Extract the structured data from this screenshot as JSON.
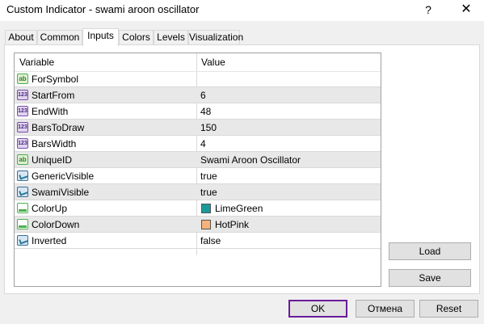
{
  "window": {
    "title": "Custom Indicator - swami aroon oscillator",
    "help": "?",
    "close": "✕"
  },
  "tabs": [
    "About",
    "Common",
    "Inputs",
    "Colors",
    "Levels",
    "Visualization"
  ],
  "active_tab": "Inputs",
  "grid": {
    "headers": {
      "variable": "Variable",
      "value": "Value"
    },
    "rows": [
      {
        "icon": "ab",
        "icon_text": "ab",
        "name": "ForSymbol",
        "value": ""
      },
      {
        "icon": "num",
        "icon_text": "123",
        "name": "StartFrom",
        "value": "6"
      },
      {
        "icon": "num",
        "icon_text": "123",
        "name": "EndWith",
        "value": "48"
      },
      {
        "icon": "num",
        "icon_text": "123",
        "name": "BarsToDraw",
        "value": "150"
      },
      {
        "icon": "num",
        "icon_text": "123",
        "name": "BarsWidth",
        "value": "4"
      },
      {
        "icon": "ab",
        "icon_text": "ab",
        "name": "UniqueID",
        "value": "Swami Aroon Oscillator"
      },
      {
        "icon": "bool",
        "icon_text": "",
        "name": "GenericVisible",
        "value": "true"
      },
      {
        "icon": "bool",
        "icon_text": "",
        "name": "SwamiVisible",
        "value": "true"
      },
      {
        "icon": "color",
        "icon_text": "",
        "name": "ColorUp",
        "value": "LimeGreen",
        "swatch": "#1a9a9a"
      },
      {
        "icon": "color",
        "icon_text": "",
        "name": "ColorDown",
        "value": "HotPink",
        "swatch": "#f5b27a"
      },
      {
        "icon": "bool",
        "icon_text": "",
        "name": "Inverted",
        "value": "false"
      }
    ]
  },
  "side_buttons": {
    "load": "Load",
    "save": "Save"
  },
  "footer_buttons": {
    "ok": "OK",
    "cancel": "Отмена",
    "reset": "Reset"
  }
}
